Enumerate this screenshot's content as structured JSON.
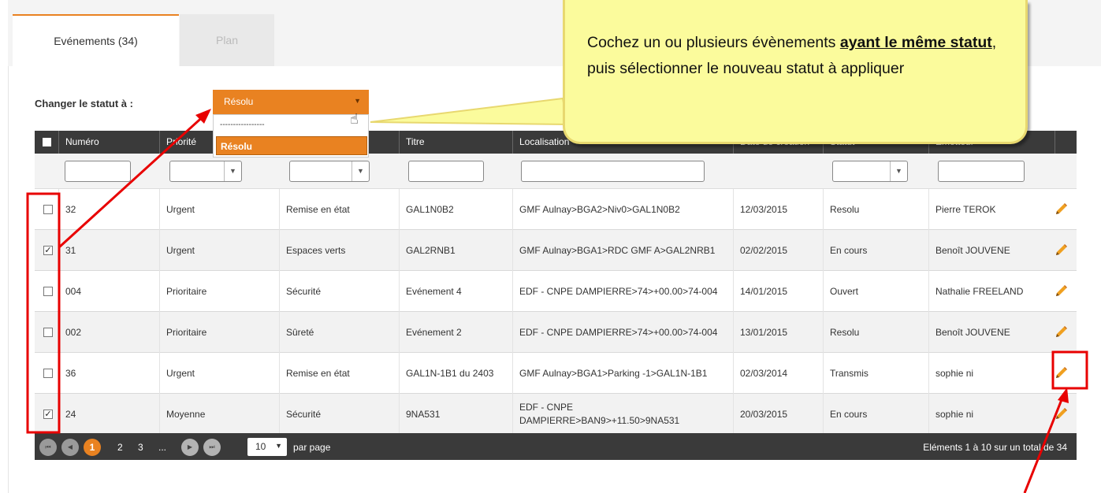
{
  "tabs": [
    {
      "label": "Evénements (34)",
      "active": true
    },
    {
      "label": "Plan",
      "active": false
    }
  ],
  "status_change": {
    "label": "Changer le statut à :",
    "selected": "Résolu",
    "options": [
      "-----------------",
      "Résolu"
    ]
  },
  "callout": {
    "text_before": "Cochez un ou plusieurs évènements ",
    "text_bold": "ayant le même statut",
    "text_after": ", puis sélectionner le nouveau statut à appliquer"
  },
  "table": {
    "columns": [
      "Numéro",
      "Priorité",
      "",
      "Titre",
      "Localisation",
      "Date de création",
      "Statut",
      "Emetteur"
    ],
    "rows": [
      {
        "checked": false,
        "numero": "32",
        "priorite": "Urgent",
        "type": "Remise en état",
        "titre": "GAL1N0B2",
        "localisation": "GMF Aulnay>BGA2>Niv0>GAL1N0B2",
        "date": "12/03/2015",
        "statut": "Resolu",
        "emetteur": "Pierre TEROK"
      },
      {
        "checked": true,
        "numero": "31",
        "priorite": "Urgent",
        "type": "Espaces verts",
        "titre": "GAL2RNB1",
        "localisation": "GMF Aulnay>BGA1>RDC GMF A>GAL2NRB1",
        "date": "02/02/2015",
        "statut": "En cours",
        "emetteur": "Benoît JOUVENE"
      },
      {
        "checked": false,
        "numero": "004",
        "priorite": "Prioritaire",
        "type": "Sécurité",
        "titre": "Evénement 4",
        "localisation": "EDF - CNPE DAMPIERRE>74>+00.00>74-004",
        "date": "14/01/2015",
        "statut": "Ouvert",
        "emetteur": "Nathalie FREELAND"
      },
      {
        "checked": false,
        "numero": "002",
        "priorite": "Prioritaire",
        "type": "Sûreté",
        "titre": "Evénement 2",
        "localisation": "EDF - CNPE DAMPIERRE>74>+00.00>74-004",
        "date": "13/01/2015",
        "statut": "Resolu",
        "emetteur": "Benoît JOUVENE"
      },
      {
        "checked": false,
        "numero": "36",
        "priorite": "Urgent",
        "type": "Remise en état",
        "titre": "GAL1N-1B1 du 2403",
        "localisation": "GMF Aulnay>BGA1>Parking -1>GAL1N-1B1",
        "date": "02/03/2014",
        "statut": "Transmis",
        "emetteur": "sophie ni"
      },
      {
        "checked": true,
        "numero": "24",
        "priorite": "Moyenne",
        "type": "Sécurité",
        "titre": "9NA531",
        "localisation": "EDF - CNPE DAMPIERRE>BAN9>+11.50>9NA531",
        "date": "20/03/2015",
        "statut": "En cours",
        "emetteur": "sophie ni"
      }
    ]
  },
  "pager": {
    "first": "⏮",
    "prev": "◀",
    "pages": [
      "1",
      "2",
      "3",
      "..."
    ],
    "current": "1",
    "next": "▶",
    "last": "⏭",
    "page_size": "10",
    "per_page_label": "par page",
    "summary": "Eléments 1 à 10 sur un total de 34"
  },
  "colors": {
    "accent": "#e98221",
    "header": "#3a3a3a",
    "callout": "#fbfb9c",
    "annotation": "#e80000"
  }
}
